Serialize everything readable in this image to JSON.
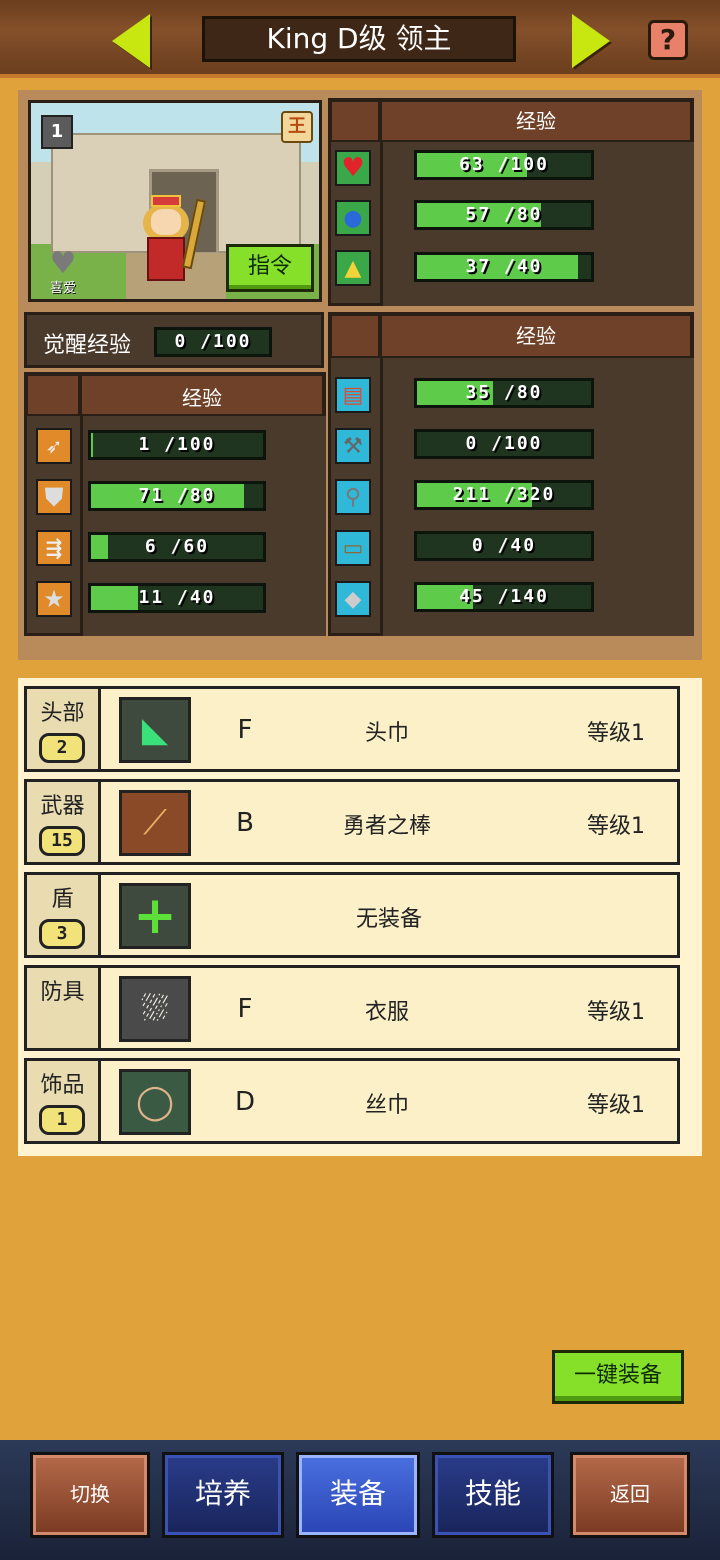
{
  "header": {
    "title": "King D级 领主",
    "help_label": "?"
  },
  "portrait": {
    "level_badge": "1",
    "rank_badge": "王",
    "like_label": "喜爱",
    "command_label": "指令"
  },
  "top_stats": {
    "header": "经验",
    "rows": [
      {
        "icon": "heart-icon",
        "label": "63 /100",
        "fraction": 0.63
      },
      {
        "icon": "potion-icon",
        "label": "57 /80",
        "fraction": 0.7125
      },
      {
        "icon": "strength-icon",
        "label": "37 /40",
        "fraction": 0.925
      }
    ]
  },
  "awakening": {
    "label": "觉醒经验",
    "value": "0 /100",
    "fraction": 0
  },
  "left_stats": {
    "header": "经验",
    "rows": [
      {
        "icon": "sword-icon",
        "label": "1 /100",
        "fraction": 0.01
      },
      {
        "icon": "shield-icon",
        "label": "71 /80",
        "fraction": 0.8875
      },
      {
        "icon": "arrows-icon",
        "label": "6 /60",
        "fraction": 0.1
      },
      {
        "icon": "star-icon",
        "label": "11 /40",
        "fraction": 0.275
      }
    ]
  },
  "right_stats": {
    "header": "经验",
    "rows": [
      {
        "icon": "book-icon",
        "label": "35 /80",
        "fraction": 0.4375
      },
      {
        "icon": "hammer-icon",
        "label": "0 /100",
        "fraction": 0
      },
      {
        "icon": "shovel-icon",
        "label": "211 /320",
        "fraction": 0.659
      },
      {
        "icon": "chest-icon",
        "label": "0 /40",
        "fraction": 0
      },
      {
        "icon": "gem-icon",
        "label": "45 /140",
        "fraction": 0.32
      }
    ]
  },
  "equipment": [
    {
      "slot": "头部",
      "count": "2",
      "rank": "F",
      "name": "头巾",
      "level": "等级1",
      "icon": "headband-icon"
    },
    {
      "slot": "武器",
      "count": "15",
      "rank": "B",
      "name": "勇者之棒",
      "level": "等级1",
      "icon": "club-icon"
    },
    {
      "slot": "盾",
      "count": "3",
      "rank": "",
      "name": "无装备",
      "level": "",
      "icon": "plus-icon"
    },
    {
      "slot": "防具",
      "count": "",
      "rank": "F",
      "name": "衣服",
      "level": "等级1",
      "icon": "clothes-icon"
    },
    {
      "slot": "饰品",
      "count": "1",
      "rank": "D",
      "name": "丝巾",
      "level": "等级1",
      "icon": "scarf-icon"
    }
  ],
  "one_key_equip": "一键装备",
  "nav": {
    "switch": "切换",
    "train": "培养",
    "equip": "装备",
    "skill": "技能",
    "back": "返回"
  },
  "colors": {
    "bar_fill": "#5ecb4a",
    "accent_green": "#86e02a",
    "background": "#e0a23a"
  }
}
